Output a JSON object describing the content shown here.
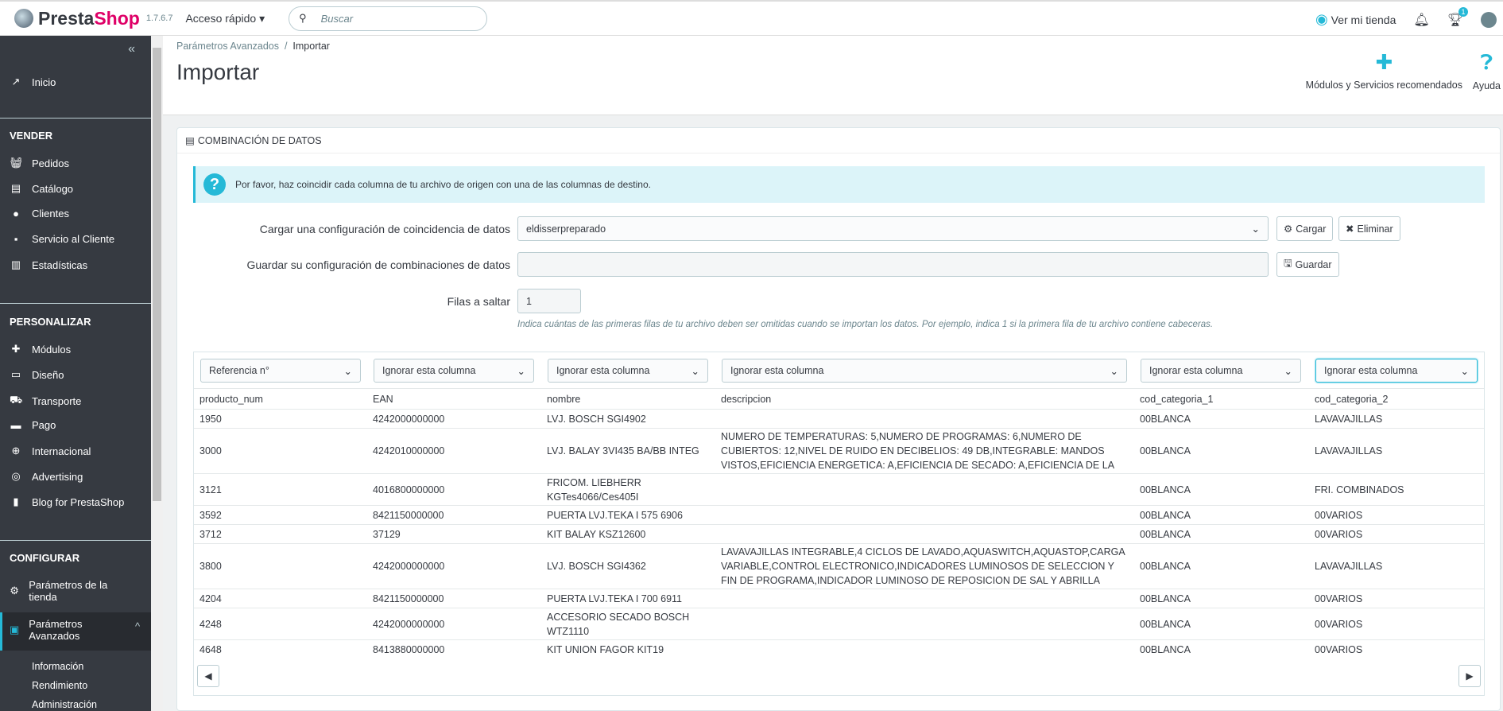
{
  "header": {
    "brand_a": "Presta",
    "brand_b": "Shop",
    "version": "1.7.6.7",
    "quick_access": "Acceso rápido ▾",
    "search_placeholder": "Buscar",
    "view_store": "Ver mi tienda",
    "notif_badge": "1"
  },
  "sidebar": {
    "collapse": "«",
    "inicio": "Inicio",
    "sections": [
      "VENDER",
      "PERSONALIZAR",
      "CONFIGURAR"
    ],
    "vender": [
      "Pedidos",
      "Catálogo",
      "Clientes",
      "Servicio al Cliente",
      "Estadísticas"
    ],
    "personalizar": [
      "Módulos",
      "Diseño",
      "Transporte",
      "Pago",
      "Internacional",
      "Advertising",
      "Blog for PrestaShop"
    ],
    "configurar": [
      "Parámetros de la tienda",
      "Parámetros Avanzados"
    ],
    "sub": [
      "Información",
      "Rendimiento",
      "Administración"
    ]
  },
  "page": {
    "breadcrumb_parent": "Parámetros Avanzados",
    "breadcrumb_sep": "/",
    "breadcrumb_current": "Importar",
    "title": "Importar",
    "modules_btn": "Módulos y Servicios recomendados",
    "help_btn": "Ayuda"
  },
  "panel": {
    "title": "COMBINACIÓN DE DATOS",
    "alert": "Por favor, haz coincidir cada columna de tu archivo de origen con una de las columnas de destino.",
    "load_label": "Cargar una configuración de coincidencia de datos",
    "load_value": "eldisserpreparado",
    "load_btn": "Cargar",
    "delete_btn": "Eliminar",
    "save_label": "Guardar su configuración de combinaciones de datos",
    "save_value": "",
    "save_btn": "Guardar",
    "skip_label": "Filas a saltar",
    "skip_value": "1",
    "skip_hint": "Indica cuántas de las primeras filas de tu archivo deben ser omitidas cuando se importan los datos. Por ejemplo, indica 1 si la primera fila de tu archivo contiene cabeceras."
  },
  "table": {
    "column_selects": [
      "Referencia n°",
      "Ignorar esta columna",
      "Ignorar esta columna",
      "Ignorar esta columna",
      "Ignorar esta columna",
      "Ignorar esta columna"
    ],
    "headers": [
      "producto_num",
      "EAN",
      "nombre",
      "descripcion",
      "cod_categoria_1",
      "cod_categoria_2"
    ],
    "rows": [
      [
        "1950",
        "4242000000000",
        "LVJ. BOSCH SGI4902",
        "",
        "00BLANCA",
        "LAVAVAJILLAS"
      ],
      [
        "3000",
        "4242010000000",
        "LVJ. BALAY 3VI435 BA/BB INTEG",
        "NUMERO DE TEMPERATURAS: 5,NUMERO DE PROGRAMAS: 6,NUMERO DE CUBIERTOS: 12,NIVEL DE RUIDO EN DECIBELIOS: 49 DB,INTEGRABLE: MANDOS VISTOS,EFICIENCIA ENERGETICA: A,EFICIENCIA DE SECADO: A,EFICIENCIA DE LA",
        "00BLANCA",
        "LAVAVAJILLAS"
      ],
      [
        "3121",
        "4016800000000",
        "FRICOM. LIEBHERR KGTes4066/Ces405I",
        "",
        "00BLANCA",
        "FRI. COMBINADOS"
      ],
      [
        "3592",
        "8421150000000",
        "PUERTA LVJ.TEKA I 575 6906",
        "",
        "00BLANCA",
        "00VARIOS"
      ],
      [
        "3712",
        "37129",
        "KIT BALAY KSZ12600",
        "",
        "00BLANCA",
        "00VARIOS"
      ],
      [
        "3800",
        "4242000000000",
        "LVJ. BOSCH SGI4362",
        "LAVAVAJILLAS INTEGRABLE,4 CICLOS DE LAVADO,AQUASWITCH,AQUASTOP,CARGA VARIABLE,CONTROL ELECTRONICO,INDICADORES LUMINOSOS DE SELECCION Y FIN DE PROGRAMA,INDICADOR LUMINOSO DE REPOSICION DE SAL Y ABRILLA",
        "00BLANCA",
        "LAVAVAJILLAS"
      ],
      [
        "4204",
        "8421150000000",
        "PUERTA LVJ.TEKA I 700 6911",
        "",
        "00BLANCA",
        "00VARIOS"
      ],
      [
        "4248",
        "4242000000000",
        "ACCESORIO SECADO BOSCH WTZ1110",
        "",
        "00BLANCA",
        "00VARIOS"
      ],
      [
        "4648",
        "8413880000000",
        "KIT UNION FAGOR KIT19",
        "",
        "00BLANCA",
        "00VARIOS"
      ]
    ]
  }
}
